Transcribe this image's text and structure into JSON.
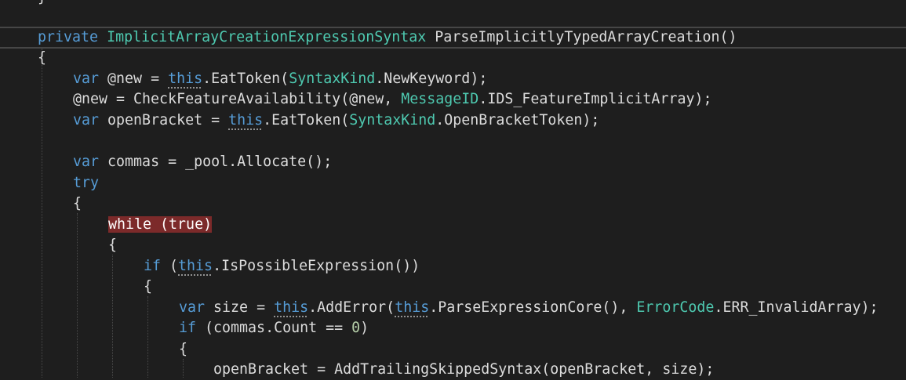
{
  "colors": {
    "background": "#1e1e1e",
    "text": "#dcdcdc",
    "keyword": "#569cd6",
    "type": "#4ec9b0",
    "number": "#b5cea8",
    "highlight": "#7c2a2a"
  },
  "code": {
    "prev_brace": "}",
    "l1": {
      "kw": "private",
      "type": "ImplicitArrayCreationExpressionSyntax",
      "rest": " ParseImplicitlyTypedArrayCreation()"
    },
    "l2": {
      "text": "{"
    },
    "l3": {
      "kw": "var",
      "a": " @new = ",
      "kw2": "this",
      "b": ".EatToken(",
      "type": "SyntaxKind",
      "c": ".NewKeyword);"
    },
    "l4": {
      "a": "@new = CheckFeatureAvailability(@new, ",
      "type": "MessageID",
      "b": ".IDS_FeatureImplicitArray);"
    },
    "l5": {
      "kw": "var",
      "a": " openBracket = ",
      "kw2": "this",
      "b": ".EatToken(",
      "type": "SyntaxKind",
      "c": ".OpenBracketToken);"
    },
    "l6": {
      "kw": "var",
      "a": " commas = _pool.Allocate();"
    },
    "l7": {
      "kw": "try"
    },
    "l8": {
      "text": "{"
    },
    "l9": {
      "kw": "while",
      "a": " (",
      "kw2": "true",
      "b": ")"
    },
    "l10": {
      "text": "{"
    },
    "l11": {
      "kw": "if",
      "a": " (",
      "kw2": "this",
      "b": ".IsPossibleExpression())"
    },
    "l12": {
      "text": "{"
    },
    "l13": {
      "kw": "var",
      "a": " size = ",
      "kw2": "this",
      "b": ".AddError(",
      "kw3": "this",
      "c": ".ParseExpressionCore(), ",
      "type": "ErrorCode",
      "d": ".ERR_InvalidArray);"
    },
    "l14": {
      "kw": "if",
      "a": " (commas.Count == ",
      "num": "0",
      "b": ")"
    },
    "l15": {
      "text": "{"
    },
    "l16": {
      "a": "openBracket = AddTrailingSkippedSyntax(openBracket, size);"
    }
  }
}
